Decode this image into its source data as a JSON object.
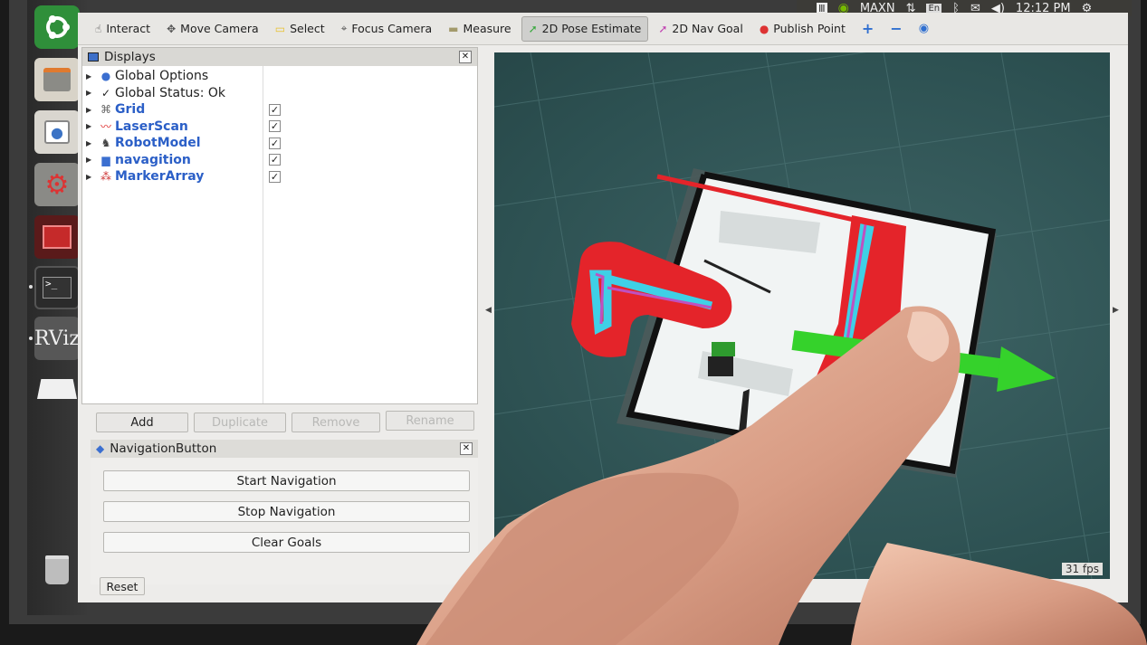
{
  "top_panel": {
    "brand": "MAXN",
    "keyboard": "En",
    "time": "12:12 PM"
  },
  "toolbar": {
    "tools": [
      {
        "label": "Interact",
        "icon": "interact-icon",
        "glyph": "☝"
      },
      {
        "label": "Move Camera",
        "icon": "move-camera-icon",
        "glyph": "✥"
      },
      {
        "label": "Select",
        "icon": "select-icon",
        "glyph": "▭"
      },
      {
        "label": "Focus Camera",
        "icon": "focus-camera-icon",
        "glyph": "⌖"
      },
      {
        "label": "Measure",
        "icon": "measure-icon",
        "glyph": "▬"
      },
      {
        "label": "2D Pose Estimate",
        "icon": "pose-estimate-icon",
        "glyph": "➚"
      },
      {
        "label": "2D Nav Goal",
        "icon": "nav-goal-icon",
        "glyph": "➚"
      },
      {
        "label": "Publish Point",
        "icon": "publish-point-icon",
        "glyph": "📍"
      }
    ]
  },
  "displays": {
    "title": "Displays",
    "items": [
      {
        "label": "Global Options",
        "icon": "globe-icon",
        "checked": false
      },
      {
        "label": "Global Status: Ok",
        "icon": "check-icon",
        "checked": false
      },
      {
        "label": "Grid",
        "icon": "grid-icon",
        "checked": true
      },
      {
        "label": "LaserScan",
        "icon": "laserscan-icon",
        "checked": true
      },
      {
        "label": "RobotModel",
        "icon": "robot-icon",
        "checked": true
      },
      {
        "label": "navagition",
        "icon": "folder-icon",
        "checked": true
      },
      {
        "label": "MarkerArray",
        "icon": "marker-icon",
        "checked": true
      }
    ],
    "check_glyph": "✓",
    "buttons": {
      "add": "Add",
      "duplicate": "Duplicate",
      "remove": "Remove",
      "rename": "Rename"
    }
  },
  "navigation_panel": {
    "title": "NavigationButton",
    "start": "Start Navigation",
    "stop": "Stop Navigation",
    "clear": "Clear Goals"
  },
  "reset": "Reset",
  "fps": "31 fps",
  "colors": {
    "costmap_red": "#e4242a",
    "path_cyan": "#3fd0e6",
    "arrow_green": "#35d22b",
    "grid_bg": "#2f5354"
  }
}
